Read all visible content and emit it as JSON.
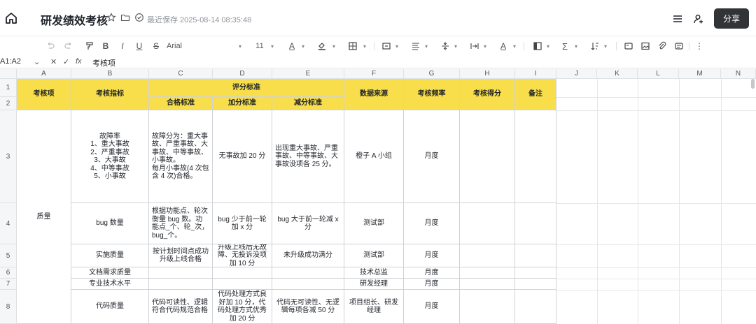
{
  "header": {
    "title": "研发绩效考核",
    "saved_text": "最近保存 2025-08-14 08:35:48",
    "share_label": "分享"
  },
  "toolbar": {
    "font_name": "Arial",
    "font_size": "11",
    "bold": "B",
    "italic": "I",
    "underline": "U",
    "strike": "S",
    "font_color_glyph": "A",
    "text_color_glyph": "A",
    "sum_glyph": "Σ"
  },
  "formula_bar": {
    "cell_ref": "A1:A2",
    "fx": "fx",
    "content": "考核项"
  },
  "columns": [
    "A",
    "B",
    "C",
    "D",
    "E",
    "F",
    "G",
    "H",
    "I",
    "J",
    "K",
    "L",
    "M",
    "N"
  ],
  "rows": [
    "1",
    "2",
    "3",
    "4",
    "5",
    "6",
    "7",
    "8"
  ],
  "table": {
    "h_item": "考核项",
    "h_indicator": "考核指标",
    "h_scoring": "评分标准",
    "h_pass": "合格标准",
    "h_plus": "加分标准",
    "h_minus": "减分标准",
    "h_source": "数据来源",
    "h_freq": "考核频率",
    "h_score": "考核得分",
    "h_note": "备注",
    "quality": "质量",
    "r3": {
      "indicator": "故障率\n1、重大事故\n2、严重事故\n3、大事故\n4、中等事故\n5、小事故",
      "pass": "故障分为：重大事故、严重事故、大事故、中等事故、小事故。\n每月小事故(4 次包含 4 次)合格。",
      "plus": "无事故加 20 分",
      "minus": "出现重大事故、严重事故、中等事故、大事故没项各 25 分。",
      "source": "橙子 A 小组",
      "freq": "月度"
    },
    "r4": {
      "indicator": "bug 数量",
      "pass": "根据功能点、轮次衡量 bug 数。功能点_个、轮_次，bug_个。",
      "plus": "bug 少于前一轮加 x 分",
      "minus": "bug 大于前一轮减 x 分",
      "source": "测试部",
      "freq": "月度"
    },
    "r5": {
      "indicator": "实施质量",
      "pass": "按计划时间点成功升级上线合格",
      "plus": "升级上线后无故障、无投诉没项加 10 分",
      "minus": "未升级成功满分",
      "source": "测试部",
      "freq": "月度"
    },
    "r6": {
      "indicator": "文档需求质量",
      "source": "技术总监",
      "freq": "月度"
    },
    "r7": {
      "indicator": "专业技术水平",
      "source": "研发经理",
      "freq": "月度"
    },
    "r8": {
      "indicator": "代码质量",
      "pass": "代码可读性、逻辑符合代码规范合格",
      "plus": "代码处理方式良好加 10 分，代码处理方式优秀加 20 分",
      "minus": "代码无可读性、无逻辑每项各减 50 分",
      "source": "项目组长、研发经理",
      "freq": "月度"
    }
  }
}
